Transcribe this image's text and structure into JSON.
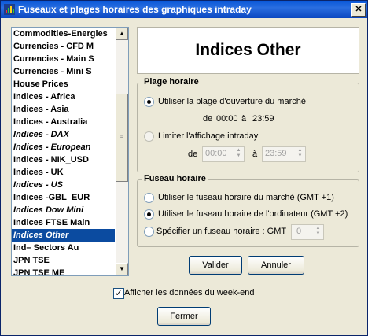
{
  "window": {
    "title": "Fuseaux et plages horaires des graphiques intraday",
    "close": "✕"
  },
  "list": {
    "items": [
      {
        "label": "Commodities-Energies",
        "italic": false
      },
      {
        "label": "Currencies - CFD M",
        "italic": false
      },
      {
        "label": "Currencies - Main S",
        "italic": false
      },
      {
        "label": "Currencies - Mini S",
        "italic": false
      },
      {
        "label": "House Prices",
        "italic": false
      },
      {
        "label": "Indices - Africa",
        "italic": false
      },
      {
        "label": "Indices - Asia",
        "italic": false
      },
      {
        "label": "Indices - Australia",
        "italic": false
      },
      {
        "label": "Indices - DAX",
        "italic": true
      },
      {
        "label": "Indices - European",
        "italic": true
      },
      {
        "label": "Indices - NIK_USD",
        "italic": false
      },
      {
        "label": "Indices - UK",
        "italic": false
      },
      {
        "label": "Indices - US",
        "italic": true
      },
      {
        "label": "Indices -GBL_EUR",
        "italic": false
      },
      {
        "label": "Indices Dow Mini",
        "italic": true
      },
      {
        "label": "Indices FTSE Main",
        "italic": false
      },
      {
        "label": "Indices Other",
        "italic": true
      },
      {
        "label": "Ind– Sectors Au",
        "italic": false
      },
      {
        "label": "JPN TSE",
        "italic": false
      },
      {
        "label": "JPN TSE ME",
        "italic": false
      }
    ],
    "selected": "Indices Other"
  },
  "heading": "Indices Other",
  "plage": {
    "title": "Plage horaire",
    "option1": "Utiliser la plage d'ouverture du marché",
    "range_de": "de",
    "range_from": "00:00",
    "range_a": "à",
    "range_to": "23:59",
    "option2": "Limiter l'affichage intraday",
    "limit_de": "de",
    "limit_from": "00:00",
    "limit_a": "à",
    "limit_to": "23:59"
  },
  "fuseau": {
    "title": "Fuseau horaire",
    "option1": "Utiliser le fuseau horaire du marché (GMT +1)",
    "option2": "Utiliser le fuseau horaire de l'ordinateur (GMT +2)",
    "option3": "Spécifier un fuseau horaire : GMT",
    "gmt_value": "0"
  },
  "buttons": {
    "valider": "Valider",
    "annuler": "Annuler",
    "fermer": "Fermer"
  },
  "weekend": {
    "label": "Afficher les données du week-end",
    "checked": true
  }
}
